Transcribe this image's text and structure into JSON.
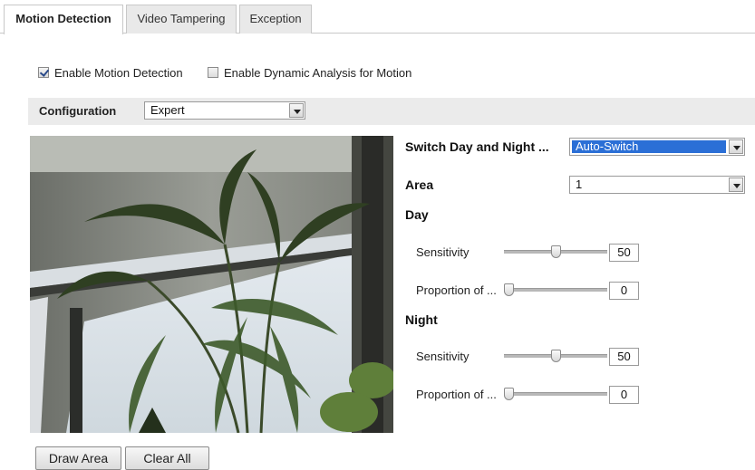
{
  "tabs": [
    {
      "label": "Motion Detection",
      "active": true
    },
    {
      "label": "Video Tampering",
      "active": false
    },
    {
      "label": "Exception",
      "active": false
    }
  ],
  "options": {
    "enable_motion_detection": {
      "label": "Enable Motion Detection",
      "checked": true
    },
    "enable_dynamic_analysis": {
      "label": "Enable Dynamic Analysis for Motion",
      "checked": false
    }
  },
  "configuration": {
    "label": "Configuration",
    "value": "Expert"
  },
  "settings": {
    "switch_day_night": {
      "label": "Switch Day and Night ...",
      "value": "Auto-Switch"
    },
    "area": {
      "label": "Area",
      "value": "1"
    },
    "day": {
      "heading": "Day",
      "sensitivity": {
        "label": "Sensitivity",
        "value": "50",
        "fraction": 0.5
      },
      "proportion": {
        "label": "Proportion of ...",
        "value": "0",
        "fraction": 0
      }
    },
    "night": {
      "heading": "Night",
      "sensitivity": {
        "label": "Sensitivity",
        "value": "50",
        "fraction": 0.5
      },
      "proportion": {
        "label": "Proportion of ...",
        "value": "0",
        "fraction": 0
      }
    }
  },
  "buttons": {
    "draw_area": "Draw Area",
    "clear_all": "Clear All"
  },
  "colors": {
    "selected_highlight": "#2b6fd6",
    "config_bar": "#ebebeb"
  }
}
